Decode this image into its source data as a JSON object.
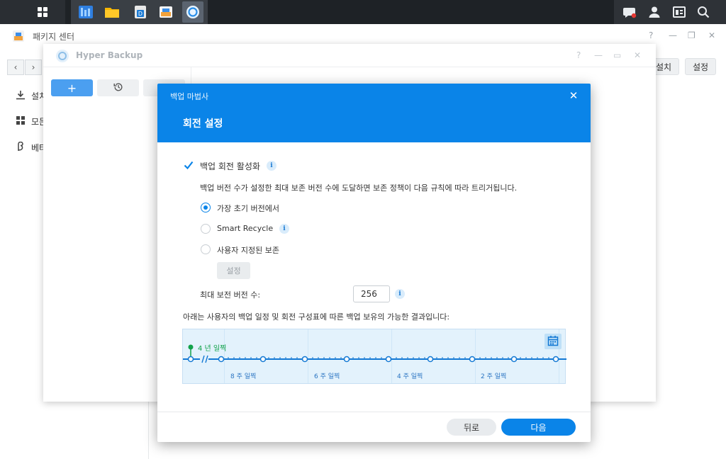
{
  "package_center": {
    "title": "패키지 센터",
    "sidebar": [
      {
        "label": "설치",
        "icon": "download-icon"
      },
      {
        "label": "모든",
        "icon": "grid-icon"
      },
      {
        "label": "베타",
        "icon": "beta-icon"
      }
    ],
    "toolbar": {
      "install_label": "설치",
      "settings_label": "설정"
    }
  },
  "hyper_backup": {
    "title": "Hyper Backup",
    "toolbar": {
      "add_label": "+"
    }
  },
  "wizard": {
    "title": "백업 마법사",
    "heading": "회전 설정",
    "enable_rotation_label": "백업 회전 활성화",
    "enable_rotation_checked": true,
    "description": "백업 버전 수가 설정한 최대 보존 버전 수에 도달하면 보존 정책이 다음 규칙에 따라 트리거됩니다.",
    "options": [
      {
        "label": "가장 초기 버전에서",
        "selected": true
      },
      {
        "label": "Smart Recycle",
        "selected": false
      },
      {
        "label": "사용자 지정된 보존",
        "selected": false
      }
    ],
    "custom_settings_label": "설정",
    "max_versions_label": "최대 보전 버전 수:",
    "max_versions_value": "256",
    "timeline_caption": "아래는 사용자의 백업 일정 및 회전 구성표에 따른 백업 보유의 가능한 결과입니다:",
    "timeline": {
      "now_label": "4 년 일찍",
      "labels": [
        "8 주 일찍",
        "6 주 일찍",
        "4 주 일찍",
        "2 주 일찍"
      ]
    },
    "back_label": "뒤로",
    "next_label": "다음"
  }
}
